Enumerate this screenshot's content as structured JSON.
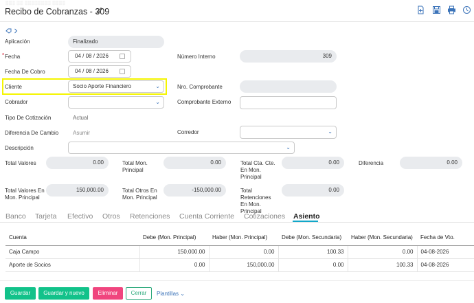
{
  "header": {
    "breadcrumb": "░░░ ░░ ░░░░░░░░ ░░░░",
    "title": "Recibo de Cobranzas - 309",
    "icons": [
      "edit-icon",
      "new-document-icon",
      "save-icon",
      "print-icon",
      "history-icon"
    ]
  },
  "nav": {
    "tag_icon": "tag-icon",
    "expand_icon": "chevron-right-icon"
  },
  "form": {
    "aplicacion_label": "Aplicación",
    "aplicacion_value": "Finalizado",
    "fecha_label": "Fecha",
    "fecha_value": "04 / 08 / 2026",
    "fecha_cobro_label": "Fecha De Cobro",
    "fecha_cobro_value": "04 / 08 / 2026",
    "cliente_label": "Cliente",
    "cliente_value": "Socio Aporte Financiero",
    "cobrador_label": "Cobrador",
    "cobrador_value": "",
    "tipo_cotizacion_label": "Tipo De Cotización",
    "tipo_cotizacion_value": "Actual",
    "diferencia_cambio_label": "Diferencia De Cambio",
    "diferencia_cambio_value": "Asumir",
    "descripcion_label": "Descripción",
    "descripcion_value": "",
    "numero_interno_label": "Número Interno",
    "numero_interno_value": "309",
    "nro_comprobante_label": "Nro. Comprobante",
    "nro_comprobante_value": "",
    "comprobante_externo_label": "Comprobante Externo",
    "comprobante_externo_value": "",
    "corredor_label": "Corredor",
    "corredor_value": ""
  },
  "totals": {
    "total_valores_label": "Total Valores",
    "total_valores_value": "0.00",
    "total_mon_principal_label": "Total Mon. Principal",
    "total_mon_principal_value": "0.00",
    "total_cta_cte_label": "Total Cta. Cte. En Mon. Principal",
    "total_cta_cte_value": "0.00",
    "diferencia_label": "Diferencia",
    "diferencia_value": "0.00",
    "total_valores_mon_label": "Total Valores En Mon. Principal",
    "total_valores_mon_value": "150,000.00",
    "total_otros_label": "Total Otros En Mon. Principal",
    "total_otros_value": "-150,000.00",
    "total_retenciones_label": "Total Retenciones En Mon. Principal",
    "total_retenciones_value": "0.00"
  },
  "tabs": [
    "Banco",
    "Tarjeta",
    "Efectivo",
    "Otros",
    "Retenciones",
    "Cuenta Corriente",
    "Cotizaciones",
    "Asiento"
  ],
  "active_tab": "Asiento",
  "table": {
    "headers": [
      "Cuenta",
      "Debe (Mon. Principal)",
      "Haber (Mon. Principal)",
      "Debe (Mon. Secundaria)",
      "Haber (Mon. Secundaria)",
      "Fecha de Vto."
    ],
    "rows": [
      [
        "Caja Campo",
        "150,000.00",
        "0.00",
        "100.33",
        "0.00",
        "04-08-2026"
      ],
      [
        "Aporte de Socios",
        "0.00",
        "150,000.00",
        "0.00",
        "100.33",
        "04-08-2026"
      ]
    ]
  },
  "actions": {
    "guardar": "Guardar",
    "guardar_nuevo": "Guardar y nuevo",
    "eliminar": "Eliminar",
    "cerrar": "Cerrar",
    "plantillas": "Plantillas"
  },
  "colors": {
    "accent": "#3b73b9",
    "green": "#12c28a",
    "pink": "#f0457e",
    "highlight": "#f5f500",
    "required": "#d0021b"
  }
}
